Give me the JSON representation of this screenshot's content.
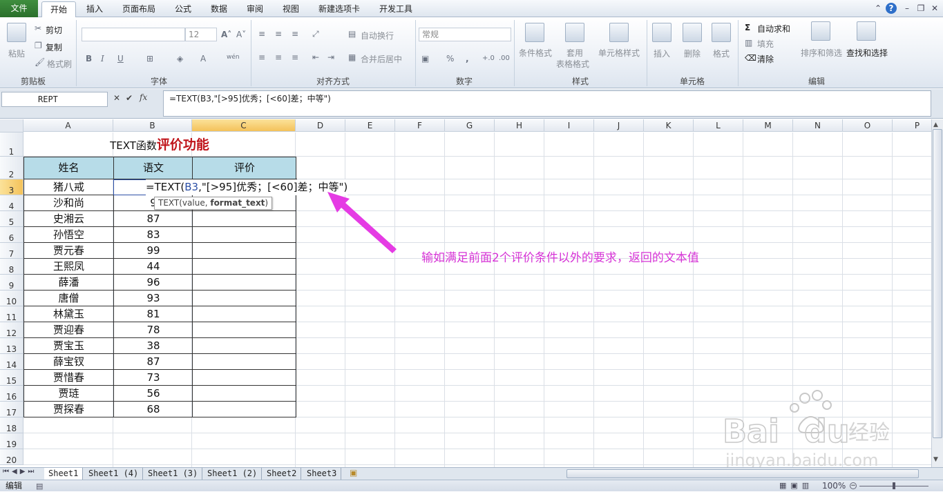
{
  "ribbon_tabs": [
    "文件",
    "开始",
    "插入",
    "页面布局",
    "公式",
    "数据",
    "审阅",
    "视图",
    "新建选项卡",
    "开发工具"
  ],
  "clipboard": {
    "paste": "粘贴",
    "cut": "剪切",
    "copy": "复制",
    "format_painter": "格式刷",
    "label": "剪贴板"
  },
  "font": {
    "size": "12",
    "bold": "B",
    "italic": "I",
    "underline": "U",
    "label": "字体"
  },
  "alignment": {
    "wrap": "自动换行",
    "merge": "合并后居中",
    "label": "对齐方式"
  },
  "number": {
    "format": "常规",
    "percent": "%",
    "comma": ",",
    "label": "数字"
  },
  "styles": {
    "cond": "条件格式",
    "table1": "套用",
    "table2": "表格格式",
    "cell": "单元格样式",
    "label": "样式"
  },
  "cells": {
    "insert": "插入",
    "delete": "删除",
    "format": "格式",
    "label": "单元格"
  },
  "editing": {
    "autosum": "自动求和",
    "fill": "填充",
    "clear": "清除",
    "sort": "排序和筛选",
    "find": "查找和选择",
    "label": "编辑"
  },
  "namebox": "REPT",
  "formula": "=TEXT(B3,\"[>95]优秀；[<60]差；中等\")",
  "columns": [
    "A",
    "B",
    "C",
    "D",
    "E",
    "F",
    "G",
    "H",
    "I",
    "J",
    "K",
    "L",
    "M",
    "N",
    "O",
    "P"
  ],
  "rows": [
    "1",
    "2",
    "3",
    "4",
    "5",
    "6",
    "7",
    "8",
    "9",
    "10",
    "11",
    "12",
    "13",
    "14",
    "15",
    "16",
    "17",
    "18",
    "19",
    "20"
  ],
  "sheet": {
    "title_prefix": "TEXT函数",
    "title_highlight": "评价功能",
    "headers": [
      "姓名",
      "语文",
      "评价"
    ],
    "names": [
      "猪八戒",
      "沙和尚",
      "史湘云",
      "孙悟空",
      "贾元春",
      "王熙凤",
      "薛潘",
      "唐僧",
      "林黛玉",
      "贾迎春",
      "贾宝玉",
      "薛宝钗",
      "贾惜春",
      "贾琏",
      "贾探春"
    ],
    "scores": [
      "",
      "9",
      "87",
      "83",
      "99",
      "44",
      "96",
      "93",
      "81",
      "78",
      "38",
      "87",
      "73",
      "56",
      "68"
    ],
    "edit_formula_pre": "=TEXT(",
    "edit_formula_ref": "B3",
    "edit_formula_post": ",\"[>95]优秀；[<60]差；中等\")",
    "tooltip_pre": "TEXT(value, ",
    "tooltip_bold": "format_text",
    "tooltip_post": ")",
    "annotation": "输如满足前面2个评价条件以外的要求，返回的文本值"
  },
  "sheet_tabs": [
    "Sheet1",
    "Sheet1 (4)",
    "Sheet1 (3)",
    "Sheet1 (2)",
    "Sheet2",
    "Sheet3"
  ],
  "status": {
    "mode": "编辑",
    "zoom": "100%"
  },
  "colors": {
    "accent_arrow": "#e53be4",
    "annotation": "#d634d6",
    "title_red": "#c0151b",
    "header_fill": "#b7dce8"
  }
}
